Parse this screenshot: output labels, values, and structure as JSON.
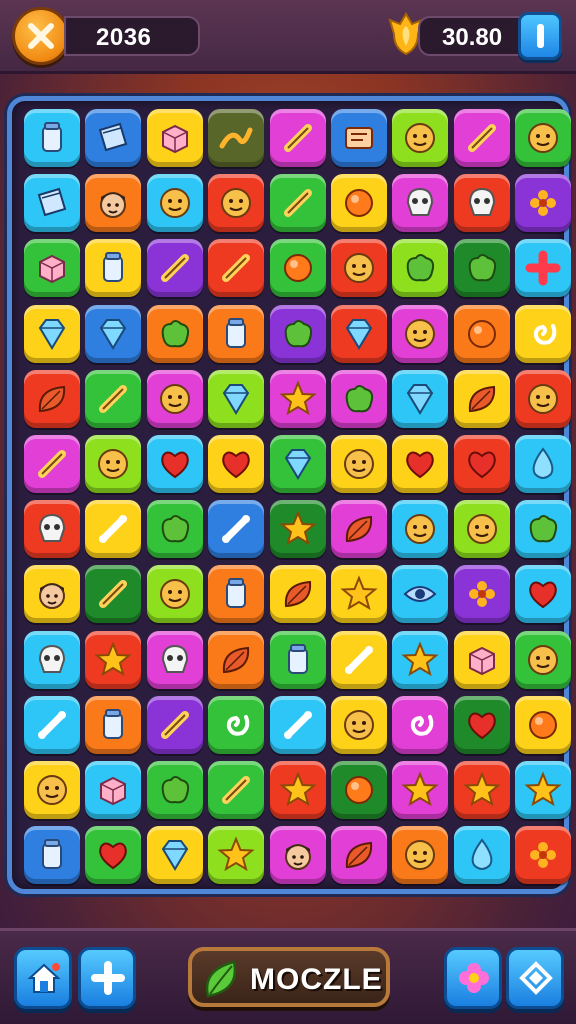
{
  "header": {
    "score": "2036",
    "coins": "30.80",
    "close_icon": "close-x-icon",
    "coin_icon": "gold-trophy-icon",
    "info_icon": "info-icon"
  },
  "board": {
    "columns": 9,
    "rows": 12,
    "tiles": [
      [
        "cyan:jar",
        "blue:book",
        "yellow:box",
        "olive:swoosh",
        "magenta:stick",
        "blue:sign",
        "lime:face",
        "magenta:stick",
        "green:face"
      ],
      [
        "cyan:book",
        "orange:boyface",
        "cyan:face",
        "red:face",
        "green:stick",
        "yellow:circle",
        "magenta:skull",
        "red:skull",
        "purple:flower"
      ],
      [
        "green:box",
        "yellow:jar",
        "purple:stick",
        "red:stick",
        "green:circle",
        "red:face",
        "lime:blob",
        "darkgreen:blob",
        "cyan:plus"
      ],
      [
        "yellow:gem",
        "blue:gem",
        "orange:blob",
        "orange:jar",
        "purple:blob",
        "red:gem",
        "magenta:face",
        "orange:circle",
        "yellow:swirl"
      ],
      [
        "red:leaf",
        "green:stick",
        "magenta:face",
        "lime:gem",
        "magenta:star",
        "magenta:blob",
        "cyan:gem",
        "yellow:leaf",
        "red:face"
      ],
      [
        "magenta:stick",
        "lime:face",
        "cyan:heart",
        "yellow:heart",
        "green:gem",
        "yellow:face",
        "yellow:heart",
        "red:heart",
        "cyan:drop"
      ],
      [
        "red:skull",
        "yellow:bone",
        "green:blob",
        "blue:bone",
        "darkgreen:star",
        "magenta:leaf",
        "cyan:face",
        "lime:face",
        "cyan:blob"
      ],
      [
        "yellow:boyface",
        "darkgreen:stick",
        "lime:face",
        "orange:jar",
        "yellow:leaf",
        "yellow:star",
        "cyan:eye",
        "purple:flower",
        "cyan:heart"
      ],
      [
        "cyan:skull",
        "red:star",
        "magenta:skull",
        "orange:leaf",
        "green:jar",
        "yellow:bone",
        "cyan:star",
        "yellow:box",
        "green:face"
      ],
      [
        "cyan:bone",
        "orange:jar",
        "purple:stick",
        "green:swirl",
        "cyan:bone",
        "yellow:face",
        "magenta:swirl",
        "darkgreen:heart",
        "yellow:circle"
      ],
      [
        "yellow:face",
        "cyan:box",
        "green:blob",
        "green:stick",
        "red:star",
        "darkgreen:circle",
        "magenta:star",
        "red:star",
        "cyan:star"
      ],
      [
        "blue:jar",
        "green:heart",
        "yellow:gem",
        "lime:star",
        "magenta:boyface",
        "magenta:leaf",
        "orange:face",
        "cyan:drop",
        "red:flower"
      ]
    ]
  },
  "footer": {
    "home_icon": "home-icon",
    "plus_icon": "plus-icon",
    "leaf_icon": "leaf-icon",
    "title": "MOCZLE",
    "flower_icon": "flower-icon",
    "gem_icon": "diamond-icon"
  },
  "colors": {
    "cyan": "#2ec6f6",
    "blue": "#2f7fe0",
    "yellow": "#ffd21a",
    "olive": "#58662a",
    "magenta": "#e23fd6",
    "lime": "#8ee01e",
    "green": "#34c23a",
    "darkgreen": "#1f8a2a",
    "red": "#ef3a22",
    "orange": "#fa7a1a",
    "purple": "#8a34d8"
  }
}
